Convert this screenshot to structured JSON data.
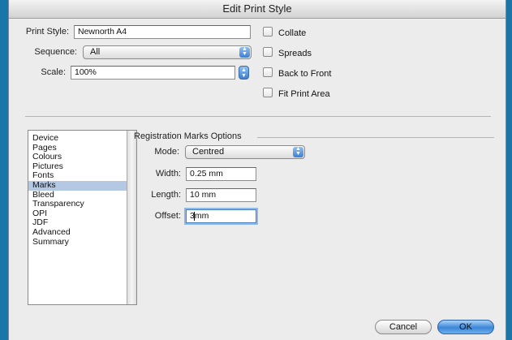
{
  "window": {
    "title": "Edit Print Style"
  },
  "form": {
    "print_style_label": "Print Style:",
    "print_style_value": "Newnorth A4",
    "sequence_label": "Sequence:",
    "sequence_value": "All",
    "scale_label": "Scale:",
    "scale_value": "100%"
  },
  "checkboxes": {
    "collate": {
      "label": "Collate",
      "checked": false
    },
    "spreads": {
      "label": "Spreads",
      "checked": false
    },
    "back_to_front": {
      "label": "Back to Front",
      "checked": false
    },
    "fit_print_area": {
      "label": "Fit Print Area",
      "checked": false
    }
  },
  "sidebar": {
    "items": [
      "Device",
      "Pages",
      "Colours",
      "Pictures",
      "Fonts",
      "Marks",
      "Bleed",
      "Transparency",
      "OPI",
      "JDF",
      "Advanced",
      "Summary"
    ],
    "selected": "Marks"
  },
  "registration": {
    "group_title": "Registration Marks Options",
    "mode_label": "Mode:",
    "mode_value": "Centred",
    "width_label": "Width:",
    "width_value": "0.25 mm",
    "length_label": "Length:",
    "length_value": "10 mm",
    "offset_label": "Offset:",
    "offset_value_before": "3",
    "offset_value_after": "mm"
  },
  "buttons": {
    "cancel": "Cancel",
    "ok": "OK"
  },
  "icons": {
    "popup": "popup-arrows-icon",
    "stepper": "stepper-arrows-icon",
    "checkbox": "checkbox-icon"
  },
  "colors": {
    "background": "#1a76a8",
    "selection": "#b5c8e3",
    "default_button": "#3c86d8"
  }
}
